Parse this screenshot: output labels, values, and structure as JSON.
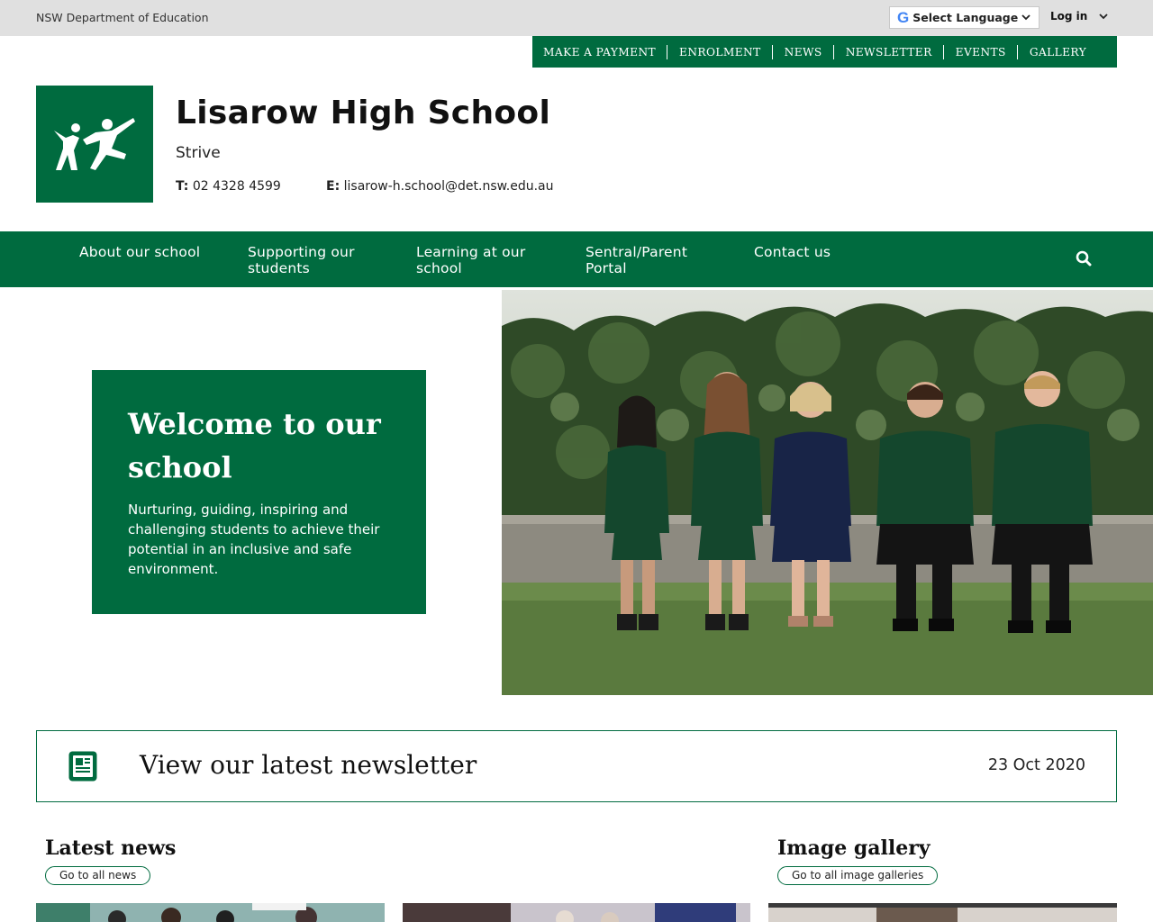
{
  "topbar": {
    "department": "NSW Department of Education",
    "language_label": "Select Language",
    "login_label": "Log in"
  },
  "quick_links": [
    "MAKE A PAYMENT",
    "ENROLMENT",
    "NEWS",
    "NEWSLETTER",
    "EVENTS",
    "GALLERY"
  ],
  "header": {
    "school_name": "Lisarow High School",
    "motto": "Strive",
    "phone_label": "T:",
    "phone": "02 4328 4599",
    "email_label": "E:",
    "email": "lisarow-h.school@det.nsw.edu.au"
  },
  "nav": {
    "items": [
      {
        "line1": "About our school",
        "line2": ""
      },
      {
        "line1": "Supporting our",
        "line2": "students"
      },
      {
        "line1": "Learning at our",
        "line2": "school"
      },
      {
        "line1": "Sentral/Parent",
        "line2": "Portal"
      },
      {
        "line1": "Contact us",
        "line2": ""
      }
    ]
  },
  "hero": {
    "title_line1": "Welcome to our",
    "title_line2": "school",
    "text": "Nurturing, guiding, inspiring and challenging students to achieve their potential in an inclusive and safe environment."
  },
  "newsletter": {
    "title": "View our latest newsletter",
    "date": "23 Oct 2020"
  },
  "news": {
    "title": "Latest news",
    "link": "Go to all news"
  },
  "gallery": {
    "title": "Image gallery",
    "link": "Go to all image galleries"
  },
  "colors": {
    "brand_green": "#006b3f",
    "topbar_grey": "#e0e0e0"
  },
  "icons": {
    "google": "google-g-icon",
    "chevron": "chevron-down-icon",
    "search": "search-icon",
    "newsletter": "newspaper-icon",
    "logo": "nsw-education-figures-logo"
  }
}
